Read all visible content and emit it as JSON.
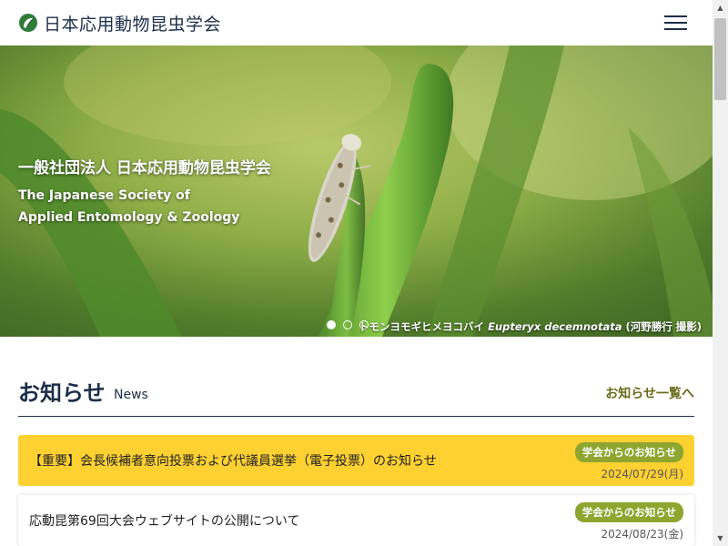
{
  "header": {
    "site_title": "日本応用動物昆虫学会",
    "logo_icon": "leaf-logo-icon",
    "menu_icon": "hamburger-menu-icon"
  },
  "hero": {
    "title_jp": "一般社団法人 日本応用動物昆虫学会",
    "title_en_line1": "The Japanese Society of",
    "title_en_line2": "Applied Entomology & Zoology",
    "caption_jp": "トモンヨモギヒメヨコバイ",
    "caption_sci": "Eupteryx decemnotata",
    "caption_credit": "(河野勝行 撮影)",
    "slides_total": 3,
    "active_slide": 1
  },
  "news": {
    "title": "お知らせ",
    "subtitle": "News",
    "view_all": "お知らせ一覧へ",
    "items": [
      {
        "text": "【重要】会長候補者意向投票および代議員選挙（電子投票）のお知らせ",
        "badge": "学会からのお知らせ",
        "date": "2024/07/29(月)"
      },
      {
        "text": "応動昆第69回大会ウェブサイトの公開について",
        "badge": "学会からのお知らせ",
        "date": "2024/08/23(金)"
      }
    ]
  },
  "colors": {
    "brand_navy": "#1c2f4a",
    "important_bg": "#fdd132",
    "badge_green": "#8ea62f",
    "link_olive": "#6b6b1a"
  }
}
